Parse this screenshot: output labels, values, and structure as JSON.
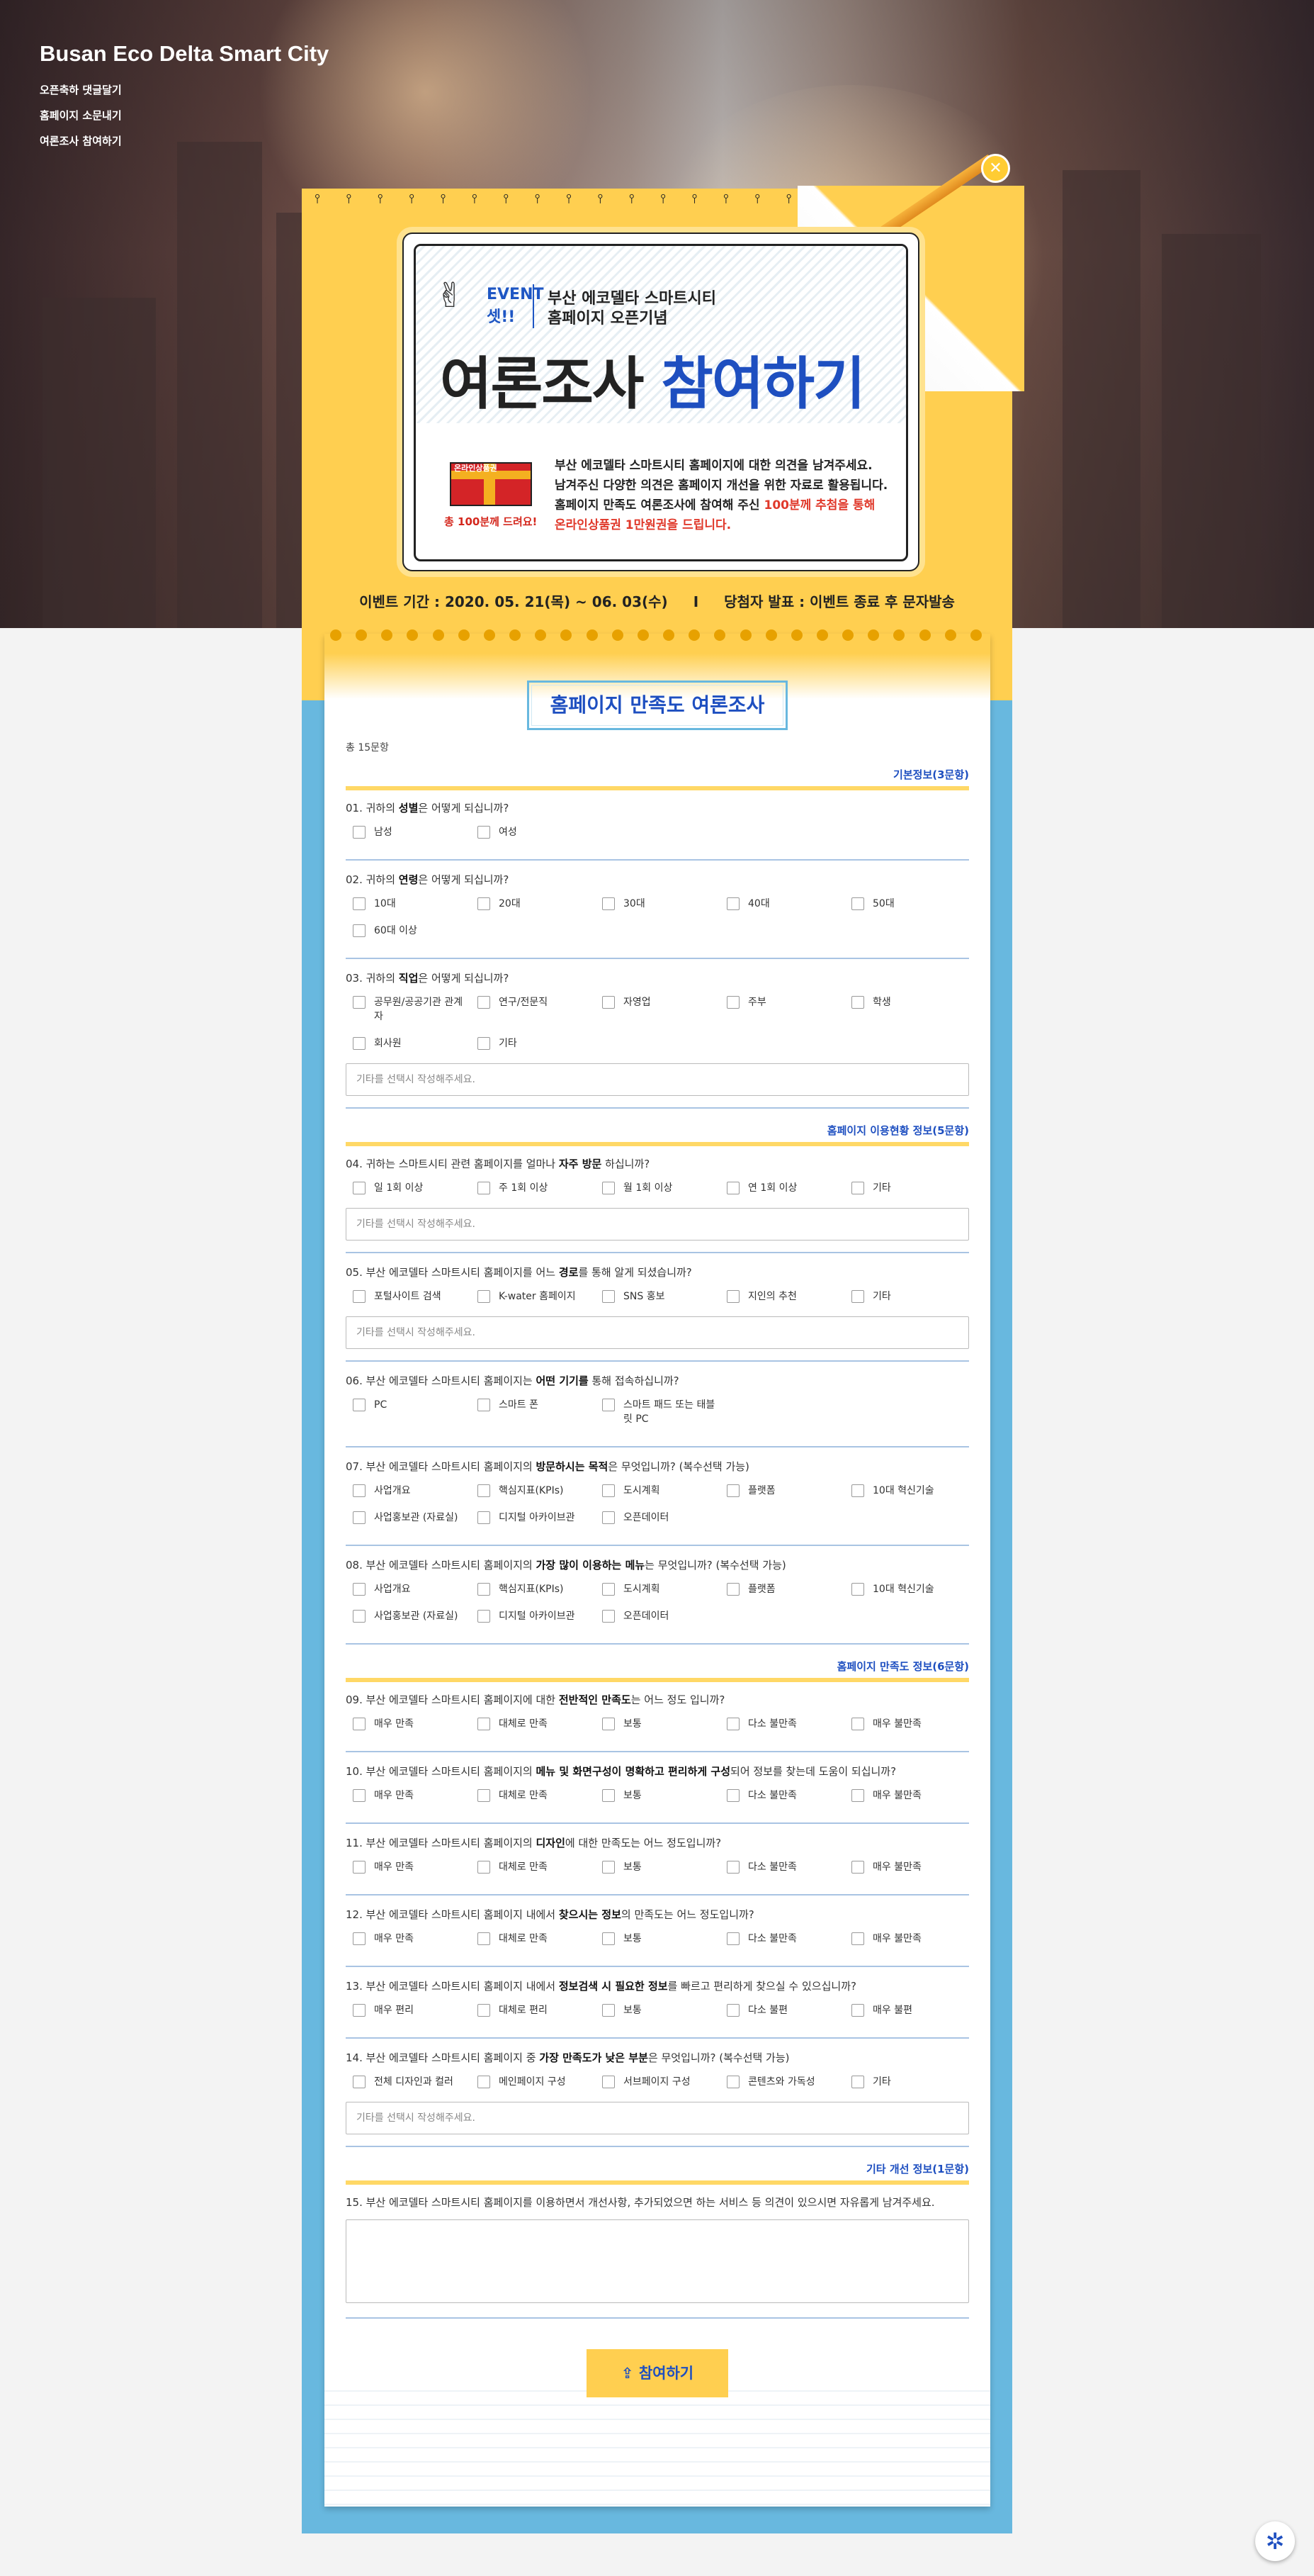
{
  "site": {
    "title": "Busan Eco Delta Smart City",
    "menu": [
      "오픈축하 댓글달기",
      "홈페이지 소문내기",
      "여론조사 참여하기"
    ]
  },
  "close_icon": "close-icon",
  "event": {
    "badge1": "EVENT",
    "badge2": "셋!!",
    "sub1": "부산 에코델타 스마트시티",
    "sub2": "홈페이지 오픈기념",
    "title_black": "여론조사 ",
    "title_blue": "참여하기",
    "gift_label": "온라인상품권",
    "gift_caption": "총 100분께 드려요!",
    "desc1": "부산 에코델타 스마트시티 홈페이지에 대한 의견을 남겨주세요.",
    "desc2": "남겨주신 다양한 의견은 홈페이지 개선을 위한 자료로 활용됩니다.",
    "desc3a": "홈페이지 만족도 여론조사에 참여해 주신 ",
    "desc3b": "100분께 추첨을 통해",
    "desc4": "온라인상품권 1만원권을 드립니다.",
    "period": "이벤트 기간 : 2020. 05. 21(목) ~ 06. 03(수)",
    "sep": "I",
    "winner": "당첨자 발표 : 이벤트 종료 후 문자발송"
  },
  "form": {
    "title": "홈페이지 만족도 여론조사",
    "total": "총 15문항",
    "placeholder": "기타를 선택시 작성해주세요.",
    "submit": "참여하기",
    "sections": [
      {
        "label": "기본정보(3문항)",
        "questions": [
          {
            "pre": "01. 귀하의 ",
            "bold": "성별",
            "post": "은 어떻게 되십니까?",
            "opts": [
              "남성",
              "여성"
            ]
          },
          {
            "pre": "02. 귀하의 ",
            "bold": "연령",
            "post": "은 어떻게 되십니까?",
            "opts": [
              "10대",
              "20대",
              "30대",
              "40대",
              "50대",
              "60대 이상"
            ]
          },
          {
            "pre": "03. 귀하의 ",
            "bold": "직업",
            "post": "은 어떻게 되십니까?",
            "opts": [
              "공무원/공공기관 관계자",
              "연구/전문직",
              "자영업",
              "주부",
              "학생",
              "회사원",
              "기타"
            ],
            "etc": true
          }
        ]
      },
      {
        "label": "홈페이지 이용현황 정보(5문항)",
        "questions": [
          {
            "pre": "04. 귀하는 스마트시티 관련 홈페이지를 얼마나 ",
            "bold": "자주 방문",
            "post": " 하십니까?",
            "opts": [
              "일 1회 이상",
              "주 1회 이상",
              "월 1회 이상",
              "연 1회 이상",
              "기타"
            ],
            "etc": true
          },
          {
            "pre": "05. 부산 에코델타 스마트시티 홈페이지를 어느 ",
            "bold": "경로",
            "post": "를 통해 알게 되셨습니까?",
            "opts": [
              "포털사이트 검색",
              "K-water 홈페이지",
              "SNS 홍보",
              "지인의 추천",
              "기타"
            ],
            "etc": true
          },
          {
            "pre": "06. 부산 에코델타 스마트시티 홈페이지는 ",
            "bold": "어떤 기기를",
            "post": " 통해 접속하십니까?",
            "opts": [
              "PC",
              "스마트 폰",
              "스마트 패드 또는 태블릿 PC"
            ]
          },
          {
            "pre": "07. 부산 에코델타 스마트시티 홈페이지의 ",
            "bold": "방문하시는 목적",
            "post": "은 무엇입니까? (복수선택 가능)",
            "opts": [
              "사업개요",
              "핵심지표(KPIs)",
              "도시계획",
              "플랫폼",
              "10대 혁신기술",
              "사업홍보관 (자료실)",
              "디지털 아카이브관",
              "오픈데이터"
            ]
          },
          {
            "pre": "08. 부산 에코델타 스마트시티 홈페이지의 ",
            "bold": "가장 많이 이용하는 메뉴",
            "post": "는 무엇입니까? (복수선택 가능)",
            "opts": [
              "사업개요",
              "핵심지표(KPIs)",
              "도시계획",
              "플랫폼",
              "10대 혁신기술",
              "사업홍보관 (자료실)",
              "디지털 아카이브관",
              "오픈데이터"
            ]
          }
        ]
      },
      {
        "label": "홈페이지 만족도 정보(6문항)",
        "questions": [
          {
            "pre": "09. 부산 에코델타 스마트시티 홈페이지에 대한 ",
            "bold": "전반적인 만족도",
            "post": "는 어느 정도 입니까?",
            "opts": [
              "매우 만족",
              "대체로 만족",
              "보통",
              "다소 불만족",
              "매우 불만족"
            ]
          },
          {
            "pre": "10. 부산 에코델타 스마트시티 홈페이지의 ",
            "bold": "메뉴 및 화면구성이 명확하고 편리하게 구성",
            "post": "되어 정보를 찾는데 도움이 되십니까?",
            "opts": [
              "매우 만족",
              "대체로 만족",
              "보통",
              "다소 불만족",
              "매우 불만족"
            ]
          },
          {
            "pre": "11. 부산 에코델타 스마트시티 홈페이지의 ",
            "bold": "디자인",
            "post": "에 대한 만족도는 어느 정도입니까?",
            "opts": [
              "매우 만족",
              "대체로 만족",
              "보통",
              "다소 불만족",
              "매우 불만족"
            ]
          },
          {
            "pre": "12. 부산 에코델타 스마트시티 홈페이지 내에서 ",
            "bold": "찾으시는 정보",
            "post": "의 만족도는 어느 정도입니까?",
            "opts": [
              "매우 만족",
              "대체로 만족",
              "보통",
              "다소 불만족",
              "매우 불만족"
            ]
          },
          {
            "pre": "13. 부산 에코델타 스마트시티 홈페이지 내에서 ",
            "bold": "정보검색 시 필요한 정보",
            "post": "를 빠르고 편리하게 찾으실 수 있으십니까?",
            "opts": [
              "매우 편리",
              "대체로 편리",
              "보통",
              "다소 불편",
              "매우 불편"
            ]
          },
          {
            "pre": "14. 부산 에코델타 스마트시티 홈페이지 중 ",
            "bold": "가장 만족도가 낮은 부분",
            "post": "은 무엇입니까? (복수선택 가능)",
            "opts": [
              "전체 디자인과 컬러",
              "메인페이지 구성",
              "서브페이지 구성",
              "콘텐츠와 가독성",
              "기타"
            ],
            "etc": true
          }
        ]
      },
      {
        "label": "기타 개선 정보(1문항)",
        "questions": [
          {
            "pre": "15. 부산 에코델타 스마트시티 홈페이지를 이용하면서 개선사항, 추가되었으면 하는 서비스 등 의견이 있으시면 자유롭게 남겨주세요.",
            "bold": "",
            "post": "",
            "opts": [],
            "textarea": true
          }
        ]
      }
    ]
  },
  "help_icon": "gear-icon"
}
